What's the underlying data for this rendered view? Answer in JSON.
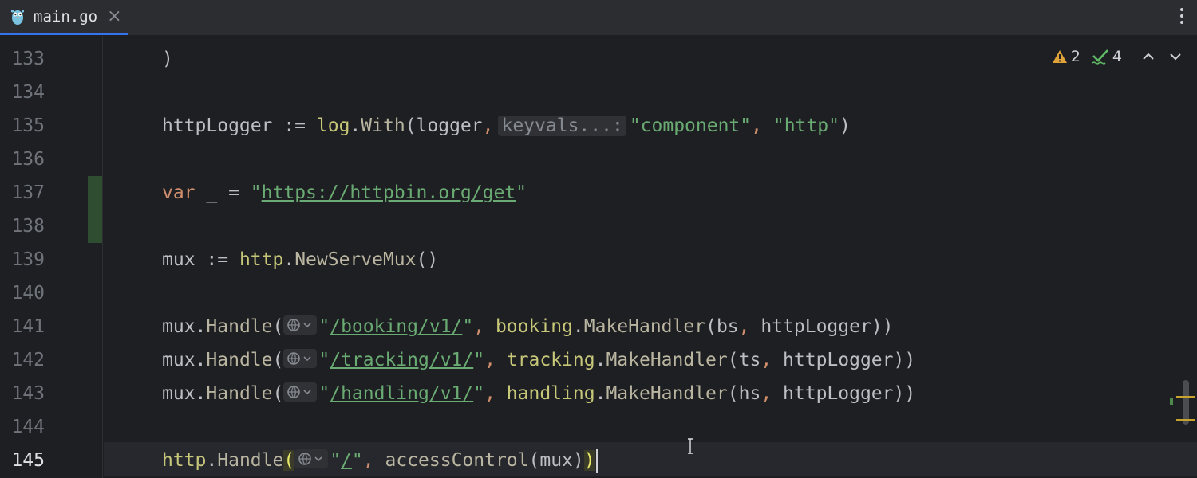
{
  "tab": {
    "label": "main.go",
    "close": "×",
    "icon": "gopher-icon"
  },
  "inspection": {
    "warnings": "2",
    "checks": "4"
  },
  "editor": {
    "lines": [
      {
        "n": "133"
      },
      {
        "n": "134"
      },
      {
        "n": "135"
      },
      {
        "n": "136"
      },
      {
        "n": "137"
      },
      {
        "n": "138"
      },
      {
        "n": "139"
      },
      {
        "n": "140"
      },
      {
        "n": "141"
      },
      {
        "n": "142"
      },
      {
        "n": "143"
      },
      {
        "n": "144"
      },
      {
        "n": "145"
      }
    ],
    "current_line": "145",
    "code": {
      "l133": ")",
      "l135": {
        "var": "httpLogger",
        "op": " := ",
        "pkg": "log",
        "fn": "With",
        "arg": "logger",
        "hint": "keyvals...:",
        "s1": "\"component\"",
        "s2": "\"http\""
      },
      "l137": {
        "kw": "var",
        "rest": " _ = ",
        "q1": "\"",
        "url": "https://httpbin.org/get",
        "q2": "\""
      },
      "l139": {
        "var": "mux",
        "op": " := ",
        "pkg": "http",
        "fn": "NewServeMux",
        "args": "()"
      },
      "l141": {
        "recv": "mux",
        "fn": "Handle",
        "path": "/booking/v1/",
        "pkg": "booking",
        "call": "MakeHandler",
        "a1": "bs",
        "a2": "httpLogger"
      },
      "l142": {
        "recv": "mux",
        "fn": "Handle",
        "path": "/tracking/v1/",
        "pkg": "tracking",
        "call": "MakeHandler",
        "a1": "ts",
        "a2": "httpLogger"
      },
      "l143": {
        "recv": "mux",
        "fn": "Handle",
        "path": "/handling/v1/",
        "pkg": "handling",
        "call": "MakeHandler",
        "a1": "hs",
        "a2": "httpLogger"
      },
      "l145": {
        "pkg": "http",
        "fn": "Handle",
        "path": "/",
        "call": "accessControl",
        "arg": "mux"
      }
    }
  },
  "colors": {
    "background": "#1e1f22",
    "keyword": "#cf8e6d",
    "string": "#6aab73",
    "function": "#56a8f5",
    "accent": "#3574f0"
  }
}
